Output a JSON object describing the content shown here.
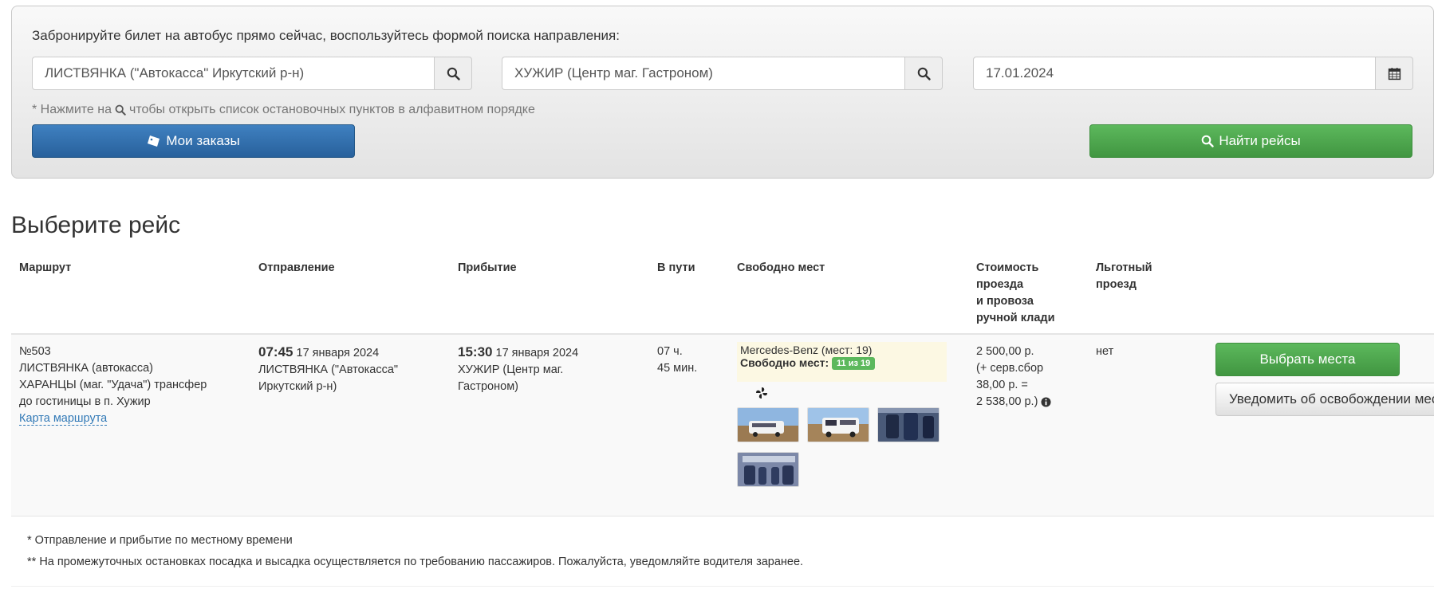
{
  "search": {
    "intro": "Забронируйте билет на автобус прямо сейчас, воспользуйтесь формой поиска направления:",
    "from_value": "ЛИСТВЯНКА (\"Автокасса\" Иркутский р-н)",
    "to_value": "ХУЖИР (Центр маг. Гастроном)",
    "date_value": "17.01.2024",
    "hint_prefix": "* Нажмите на",
    "hint_suffix": "чтобы открыть список остановочных пунктов в алфавитном порядке",
    "orders_label": "Мои заказы",
    "find_label": "Найти рейсы"
  },
  "section_title": "Выберите рейс",
  "table": {
    "headers": {
      "route": "Маршрут",
      "departure": "Отправление",
      "arrival": "Прибытие",
      "duration": "В пути",
      "seats": "Свободно мест",
      "price_1": "Стоимость",
      "price_2": "проезда",
      "price_3": "и провоза",
      "price_4": "ручной клади",
      "benefit_1": "Льготный",
      "benefit_2": "проезд"
    },
    "row": {
      "route_number": "№503",
      "route_line1": "ЛИСТВЯНКА (автокасса)",
      "route_line2": "ХАРАНЦЫ (маг. \"Удача\") трансфер",
      "route_line3": "до гостиницы в п. Хужир",
      "route_map_link": "Карта маршрута",
      "dep_time": "07:45",
      "dep_date": "17 января 2024",
      "dep_place1": "ЛИСТВЯНКА (\"Автокасса\"",
      "dep_place2": "Иркутский р-н)",
      "arr_time": "15:30",
      "arr_date": "17 января 2024",
      "arr_place1": "ХУЖИР (Центр маг.",
      "arr_place2": "Гастроном)",
      "duration_hours": "07 ч.",
      "duration_minutes": "45 мин.",
      "bus_model": "Mercedes-Benz (мест: 19)",
      "free_seats_label": "Свободно мест:",
      "free_seats_badge": "11 из 19",
      "price_line1": "2 500,00 р.",
      "price_line2": "(+ серв.сбор",
      "price_line3": "38,00 р. =",
      "price_line4": "2 538,00 р.)",
      "benefit": "нет",
      "select_label": "Выбрать места",
      "notify_label": "Уведомить об освобождении мест"
    }
  },
  "footnotes": {
    "note1": "* Отправление и прибытие по местному времени",
    "note2": "** На промежуточных остановках посадка и высадка осуществляется по требованию пассажиров. Пожалуйста, уведомляйте водителя заранее."
  },
  "colors": {
    "primary_blue": "#28619c",
    "success_green": "#419641",
    "link_blue": "#337ab7",
    "bus_highlight": "#fcf8e3"
  }
}
